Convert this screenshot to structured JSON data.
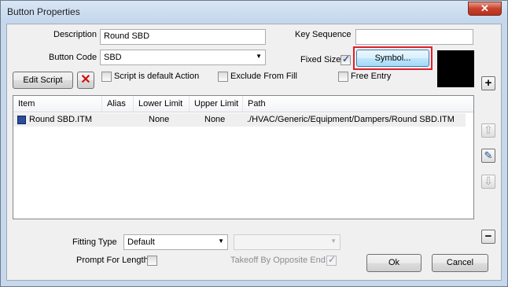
{
  "window": {
    "title": "Button Properties",
    "close_glyph": "✕"
  },
  "form": {
    "description_label": "Description",
    "description_value": "Round SBD",
    "key_sequence_label": "Key Sequence",
    "key_sequence_value": "",
    "button_code_label": "Button Code",
    "button_code_value": "SBD",
    "fixed_size_label": "Fixed Size",
    "fixed_size_checked": true,
    "symbol_button_label": "Symbol...",
    "symbol_preview_color": "#000000",
    "edit_script_label": "Edit Script",
    "script_default_label": "Script is default Action",
    "exclude_from_fill_label": "Exclude From Fill",
    "free_entry_label": "Free Entry"
  },
  "list": {
    "columns": [
      "Item",
      "Alias",
      "Lower Limit",
      "Upper Limit",
      "Path"
    ],
    "rows": [
      {
        "item": "Round SBD.ITM",
        "alias": "",
        "lower": "None",
        "upper": "None",
        "path": "./HVAC/Generic/Equipment/Dampers/Round SBD.ITM"
      }
    ]
  },
  "side_buttons": {
    "add_glyph": "+",
    "up_glyph": "⇧",
    "edit_glyph": "✎",
    "down_glyph": "⇩",
    "remove_glyph": "−"
  },
  "bottom": {
    "fitting_type_label": "Fitting Type",
    "fitting_type_value": "Default",
    "second_combo_value": "",
    "prompt_for_length_label": "Prompt For Length",
    "takeoff_label": "Takeoff By Opposite End",
    "takeoff_checked": true,
    "ok_label": "Ok",
    "cancel_label": "Cancel"
  },
  "colors": {
    "highlight_red": "#e0202a",
    "symbol_button_blue": "#bcdcf6"
  }
}
